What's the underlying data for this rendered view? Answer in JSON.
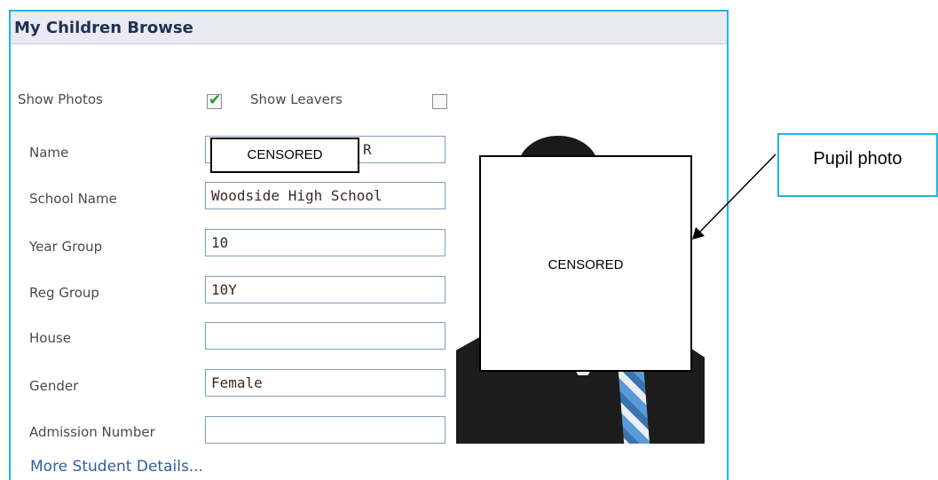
{
  "panel": {
    "title": "My Children Browse"
  },
  "options": {
    "show_photos_label": "Show Photos",
    "show_photos_checked": true,
    "show_leavers_label": "Show Leavers",
    "show_leavers_checked": false
  },
  "fields": [
    {
      "label": "Name",
      "value": "R"
    },
    {
      "label": "School Name",
      "value": "Woodside High School"
    },
    {
      "label": "Year Group",
      "value": "10"
    },
    {
      "label": "Reg Group",
      "value": "10Y"
    },
    {
      "label": "House",
      "value": ""
    },
    {
      "label": "Gender",
      "value": "Female"
    },
    {
      "label": "Admission Number",
      "value": ""
    }
  ],
  "censor_labels": {
    "name": "CENSORED",
    "photo": "CENSORED"
  },
  "more_link": "More Student Details...",
  "callout": {
    "text": "Pupil photo"
  },
  "colors": {
    "panel_border": "#1bb8e6",
    "header_bg": "#e9eaf2",
    "title_text": "#1f3251",
    "link_text": "#2e5fa3",
    "field_border": "#7f9db9",
    "checkbox_tick": "#1f9d3a"
  },
  "icons": {
    "checked": "check-icon"
  }
}
